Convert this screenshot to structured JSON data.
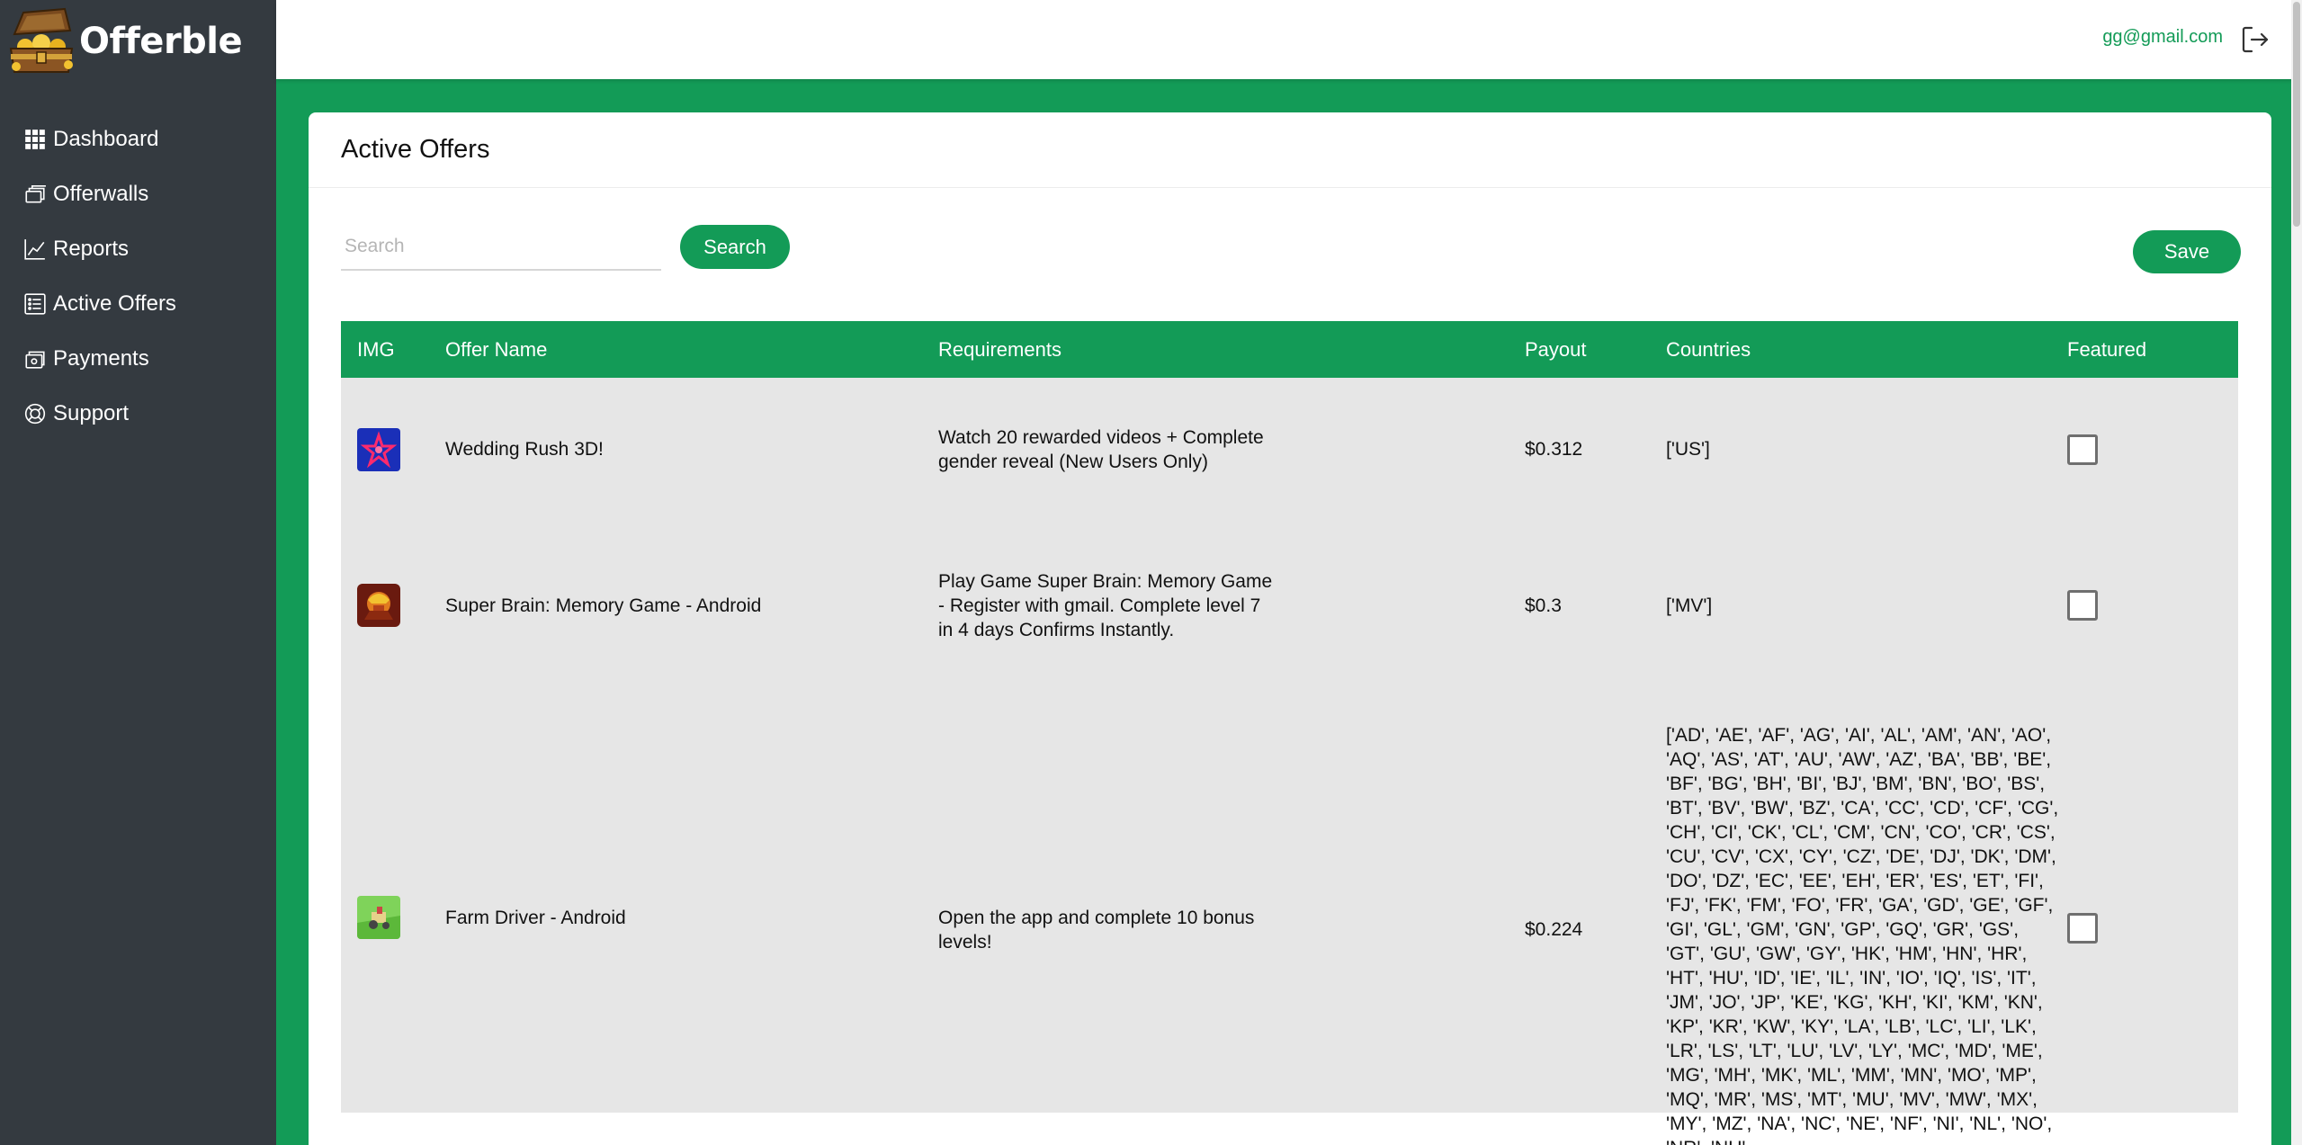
{
  "brand": {
    "name": "Offerble"
  },
  "sidebar": {
    "items": [
      {
        "label": "Dashboard",
        "icon": "grid-icon"
      },
      {
        "label": "Offerwalls",
        "icon": "layers-icon"
      },
      {
        "label": "Reports",
        "icon": "chart-icon"
      },
      {
        "label": "Active Offers",
        "icon": "list-icon"
      },
      {
        "label": "Payments",
        "icon": "cash-icon"
      },
      {
        "label": "Support",
        "icon": "lifebuoy-icon"
      }
    ]
  },
  "header": {
    "email": "gg@gmail.com",
    "logout_icon": "logout-icon"
  },
  "page": {
    "title": "Active Offers",
    "search_placeholder": "Search",
    "search_label": "Search",
    "save_label": "Save"
  },
  "table": {
    "columns": [
      "IMG",
      "Offer Name",
      "Requirements",
      "Payout",
      "Countries",
      "Featured"
    ],
    "rows": [
      {
        "name": "Wedding Rush 3D!",
        "requirements": "Watch 20 rewarded videos + Complete gender reveal (New Users Only)",
        "payout": "$0.312",
        "countries": "['US']",
        "featured": false
      },
      {
        "name": "Super Brain: Memory Game - Android",
        "requirements": "Play Game Super Brain: Memory Game - Register with gmail. Complete level 7 in 4 days Confirms Instantly.",
        "payout": "$0.3",
        "countries": "['MV']",
        "featured": false
      },
      {
        "name": "Farm Driver - Android",
        "requirements": "Open the app and complete 10 bonus levels!",
        "payout": "$0.224",
        "countries": "['AD', 'AE', 'AF', 'AG', 'AI', 'AL', 'AM', 'AN', 'AO', 'AQ', 'AS', 'AT', 'AU', 'AW', 'AZ', 'BA', 'BB', 'BE', 'BF', 'BG', 'BH', 'BI', 'BJ', 'BM', 'BN', 'BO', 'BS', 'BT', 'BV', 'BW', 'BZ', 'CA', 'CC', 'CD', 'CF', 'CG', 'CH', 'CI', 'CK', 'CL', 'CM', 'CN', 'CO', 'CR', 'CS', 'CU', 'CV', 'CX', 'CY', 'CZ', 'DE', 'DJ', 'DK', 'DM', 'DO', 'DZ', 'EC', 'EE', 'EH', 'ER', 'ES', 'ET', 'FI', 'FJ', 'FK', 'FM', 'FO', 'FR', 'GA', 'GD', 'GE', 'GF', 'GI', 'GL', 'GM', 'GN', 'GP', 'GQ', 'GR', 'GS', 'GT', 'GU', 'GW', 'GY', 'HK', 'HM', 'HN', 'HR', 'HT', 'HU', 'ID', 'IE', 'IL', 'IN', 'IO', 'IQ', 'IS', 'IT', 'JM', 'JO', 'JP', 'KE', 'KG', 'KH', 'KI', 'KM', 'KN', 'KP', 'KR', 'KW', 'KY', 'LA', 'LB', 'LC', 'LI', 'LK', 'LR', 'LS', 'LT', 'LU', 'LV', 'LY', 'MC', 'MD', 'ME', 'MG', 'MH', 'MK', 'ML', 'MM', 'MN', 'MO', 'MP', 'MQ', 'MR', 'MS', 'MT', 'MU', 'MV', 'MW', 'MX', 'MY', 'MZ', 'NA', 'NC', 'NE', 'NF', 'NI', 'NL', 'NO', 'NR', 'NU',",
        "featured": false
      }
    ]
  },
  "colors": {
    "accent": "#139b57",
    "sidebar": "#343a40",
    "row_bg": "#e6e6e6"
  }
}
